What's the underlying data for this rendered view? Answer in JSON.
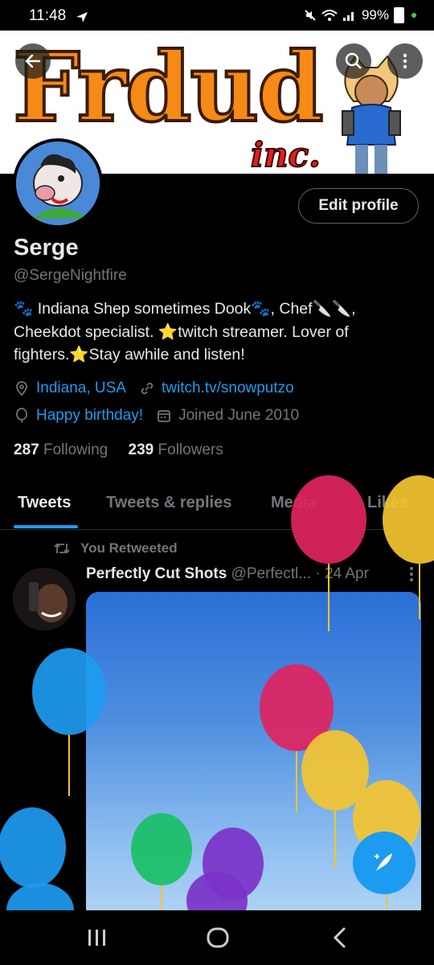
{
  "status_bar": {
    "time": "11:48",
    "battery": "99%"
  },
  "banner": {
    "title": "Frdud",
    "subtitle": "inc."
  },
  "header": {
    "edit_profile_label": "Edit profile"
  },
  "profile": {
    "name": "Serge",
    "handle": "@SergeNightfire",
    "bio_line1": "🐾 Indiana Shep sometimes Dook🐾, Chef🔪🔪,",
    "bio_line2": "Cheekdot specialist. ⭐twitch streamer. Lover of",
    "bio_line3": "fighters.⭐Stay awhile and listen!",
    "location": "Indiana, USA",
    "website": "twitch.tv/snowputzo",
    "birthday": "Happy birthday!",
    "joined": "Joined June 2010",
    "following_count": "287",
    "following_label": "Following",
    "followers_count": "239",
    "followers_label": "Followers"
  },
  "tabs": [
    {
      "label": "Tweets"
    },
    {
      "label": "Tweets & replies"
    },
    {
      "label": "Media"
    },
    {
      "label": "Likes"
    }
  ],
  "tweet": {
    "retweet_label": "You Retweeted",
    "author": "Perfectly Cut Shots",
    "handle": "@Perfectl...",
    "separator": "·",
    "date": "24 Apr"
  },
  "colors": {
    "accent": "#1d9bf0",
    "background": "#000000",
    "text": "#e7e9ea",
    "muted": "#71767b"
  }
}
